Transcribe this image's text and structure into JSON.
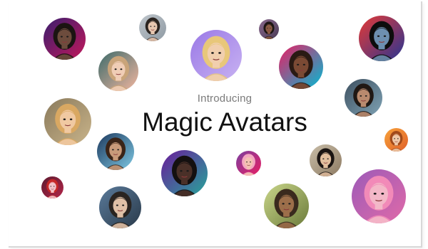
{
  "headline": {
    "intro": "Introducing",
    "title": "Magic Avatars"
  },
  "avatars": [
    {
      "icon": "portrait-icon",
      "bg": "#3a1e6e",
      "bg2": "#c2185b",
      "skin": "#6d4c3d",
      "hair": "#1b1412"
    },
    {
      "icon": "portrait-icon",
      "bg": "#bfc6cc",
      "bg2": "#8f9aa3",
      "skin": "#e7c7b0",
      "hair": "#2b2420"
    },
    {
      "icon": "portrait-icon",
      "bg": "#9a79e6",
      "bg2": "#c8b2f2",
      "skin": "#f1cfae",
      "hair": "#e8c77a"
    },
    {
      "icon": "portrait-icon",
      "bg": "#8a6a8e",
      "bg2": "#4a3a55",
      "skin": "#8a5a44",
      "hair": "#1e1614"
    },
    {
      "icon": "portrait-icon",
      "bg": "#e53935",
      "bg2": "#283593",
      "skin": "#6d8fb0",
      "hair": "#0d0d0d"
    },
    {
      "icon": "portrait-icon",
      "bg": "#3d6b6a",
      "bg2": "#f2b6a0",
      "skin": "#f0cdb6",
      "hair": "#c9a47a"
    },
    {
      "icon": "portrait-icon",
      "bg": "#e91e63",
      "bg2": "#00bcd4",
      "skin": "#7b4a34",
      "hair": "#2a1a14"
    },
    {
      "icon": "portrait-icon",
      "bg": "#3e5060",
      "bg2": "#7fa3b5",
      "skin": "#b98a6e",
      "hair": "#201814"
    },
    {
      "icon": "portrait-icon",
      "bg": "#8a7a5c",
      "bg2": "#c9b48a",
      "skin": "#f0c9a2",
      "hair": "#d9a862"
    },
    {
      "icon": "portrait-icon",
      "bg": "#1e3a5f",
      "bg2": "#7ec8e3",
      "skin": "#c89a7a",
      "hair": "#3a2418"
    },
    {
      "icon": "portrait-icon",
      "bg": "#6a1b9a",
      "bg2": "#26a69a",
      "skin": "#4a3028",
      "hair": "#141010"
    },
    {
      "icon": "portrait-icon",
      "bg": "#7b3fa0",
      "bg2": "#e91e63",
      "skin": "#f3c1b2",
      "hair": "#f4a6c0"
    },
    {
      "icon": "portrait-icon",
      "bg": "#c8bda8",
      "bg2": "#8d7a62",
      "skin": "#e2bf9e",
      "hair": "#1a1412"
    },
    {
      "icon": "portrait-icon",
      "bg": "#f7a23a",
      "bg2": "#e0602a",
      "skin": "#f0c9a8",
      "hair": "#a14a1a"
    },
    {
      "icon": "portrait-icon",
      "bg": "#5c1a2e",
      "bg2": "#b3264a",
      "skin": "#f2c2c8",
      "hair": "#c62828"
    },
    {
      "icon": "portrait-icon",
      "bg": "#5a7a9a",
      "bg2": "#2a3a4a",
      "skin": "#e0c0a6",
      "hair": "#2a2420"
    },
    {
      "icon": "portrait-icon",
      "bg": "#c9d68a",
      "bg2": "#6b7a3a",
      "skin": "#9c6e4a",
      "hair": "#3a2a1e"
    },
    {
      "icon": "portrait-icon",
      "bg": "#9c5ab8",
      "bg2": "#e06aa8",
      "skin": "#f3b8c8",
      "hair": "#f28ab8"
    }
  ]
}
